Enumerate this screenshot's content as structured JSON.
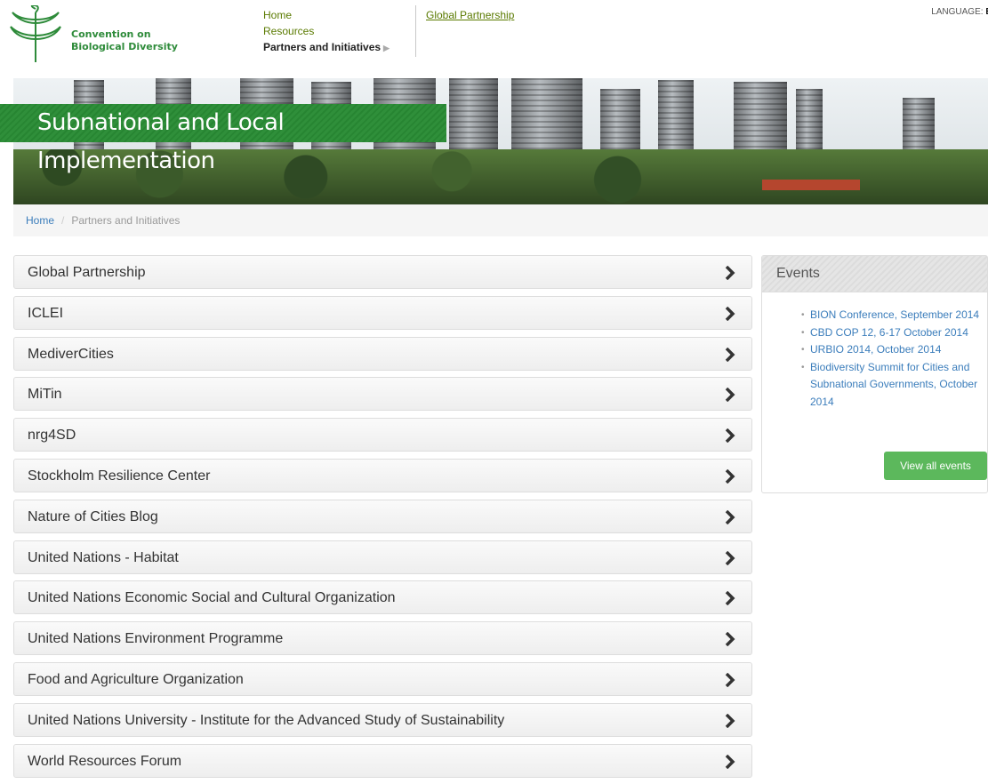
{
  "header": {
    "logo_line1": "Convention on",
    "logo_line2": "Biological Diversity",
    "nav": [
      "Home",
      "Resources",
      "Partners and Initiatives"
    ],
    "subnav": "Global Partnership",
    "language_label": "LANGUAGE:",
    "language_value": "E"
  },
  "banner": {
    "title": "Subnational and Local Implementation"
  },
  "breadcrumb": {
    "home": "Home",
    "separator": "/",
    "current": "Partners and Initiatives"
  },
  "list": [
    "Global Partnership",
    "ICLEI",
    "MediverCities",
    "MiTin",
    "nrg4SD",
    "Stockholm Resilience Center",
    "Nature of Cities Blog",
    "United Nations - Habitat",
    "United Nations Economic Social and Cultural Organization",
    "United Nations Environment Programme",
    "Food and Agriculture Organization",
    "United Nations University - Institute for the Advanced Study of Sustainability",
    "World Resources Forum"
  ],
  "events": {
    "title": "Events",
    "items": [
      "BION Conference, September 2014",
      "CBD COP 12, 6-17 October 2014",
      "URBIO 2014, October 2014",
      "Biodiversity Summit for Cities and Subnational Governments, October 2014"
    ],
    "view_all": "View all events"
  },
  "colors": {
    "accent_green": "#2f8f3a",
    "link_blue": "#3b7dbb",
    "button_green": "#5cb85c"
  }
}
